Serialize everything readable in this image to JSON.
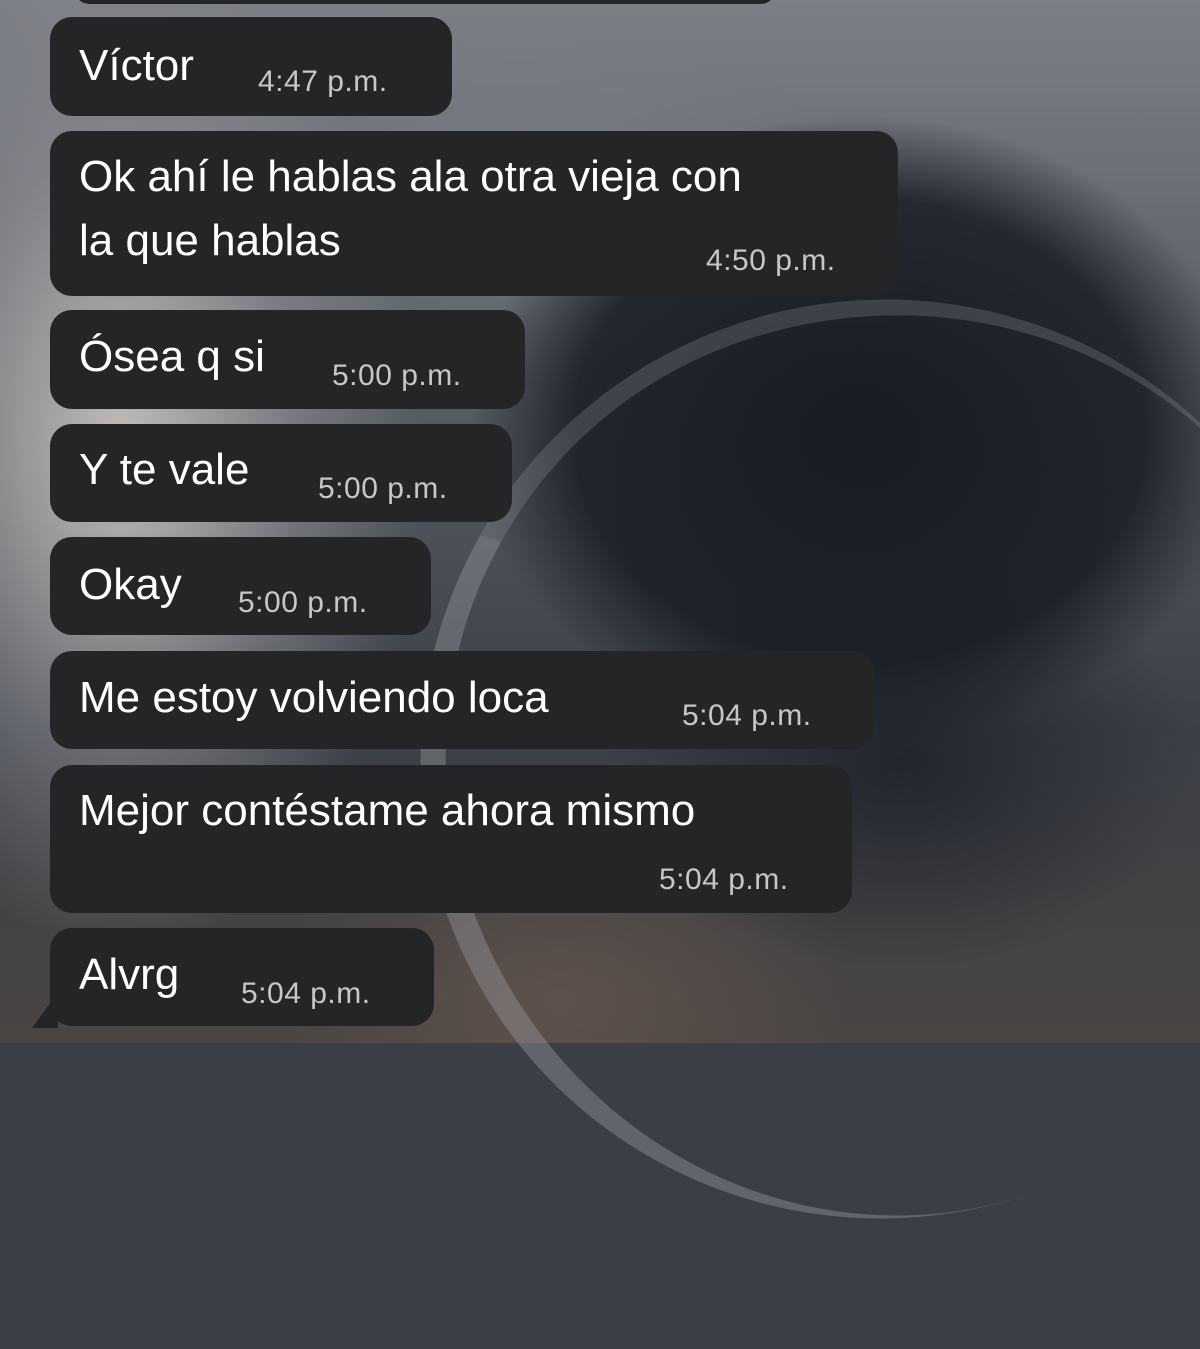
{
  "colors": {
    "bubble_bg": "#242527",
    "message_text": "#ffffff",
    "timestamp_text": "#c7c7c9"
  },
  "messages": [
    {
      "text": "Víctor",
      "time": "4:47 p.m."
    },
    {
      "text": "Ok ahí le hablas ala otra vieja con\nla que hablas",
      "time": "4:50 p.m."
    },
    {
      "text": "Ósea q si",
      "time": "5:00 p.m."
    },
    {
      "text": "Y te vale",
      "time": "5:00 p.m."
    },
    {
      "text": "Okay",
      "time": "5:00 p.m."
    },
    {
      "text": "Me estoy volviendo loca",
      "time": "5:04 p.m."
    },
    {
      "text": "Mejor contéstame ahora mismo",
      "time": "5:04 p.m."
    },
    {
      "text": "Alvrg",
      "time": "5:04 p.m."
    }
  ]
}
